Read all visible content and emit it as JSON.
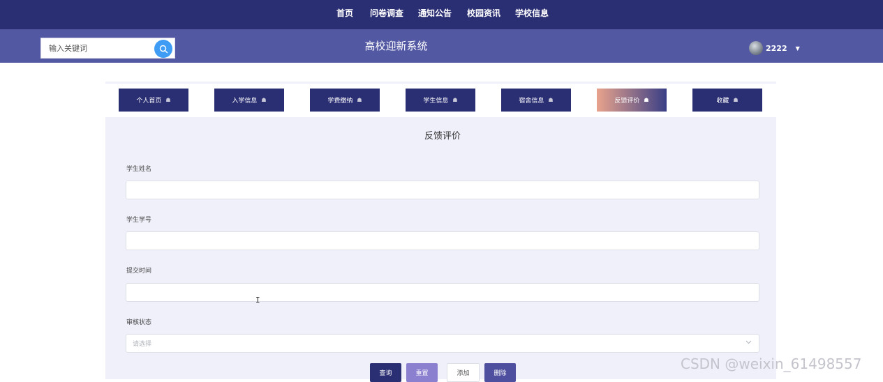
{
  "topnav": {
    "items": [
      "首页",
      "问卷调查",
      "通知公告",
      "校园资讯",
      "学校信息"
    ]
  },
  "header": {
    "search_placeholder": "输入关键词",
    "title": "高校迎新系统",
    "username": "2222"
  },
  "tabs": [
    {
      "label": "个人首页",
      "active": false
    },
    {
      "label": "入学信息",
      "active": false
    },
    {
      "label": "学费缴纳",
      "active": false
    },
    {
      "label": "学生信息",
      "active": false
    },
    {
      "label": "宿舍信息",
      "active": false
    },
    {
      "label": "反馈评价",
      "active": true
    },
    {
      "label": "收藏",
      "active": false
    }
  ],
  "form": {
    "title": "反馈评价",
    "fields": {
      "student_name": {
        "label": "学生姓名",
        "value": ""
      },
      "student_id": {
        "label": "学生学号",
        "value": ""
      },
      "submit_time": {
        "label": "提交时间",
        "value": ""
      },
      "review_status": {
        "label": "审核状态",
        "placeholder": "请选择"
      }
    },
    "buttons": {
      "query": "查询",
      "reset": "重置",
      "add": "添加",
      "delete": "删除"
    }
  },
  "colors": {
    "nav_bg": "#2a2e73",
    "header_bg": "#5358a3",
    "search_button": "#3f9cf5",
    "panel_bg": "#f0f0fb",
    "reset_button": "#8b7fd0"
  },
  "watermark": "CSDN @weixin_61498557"
}
